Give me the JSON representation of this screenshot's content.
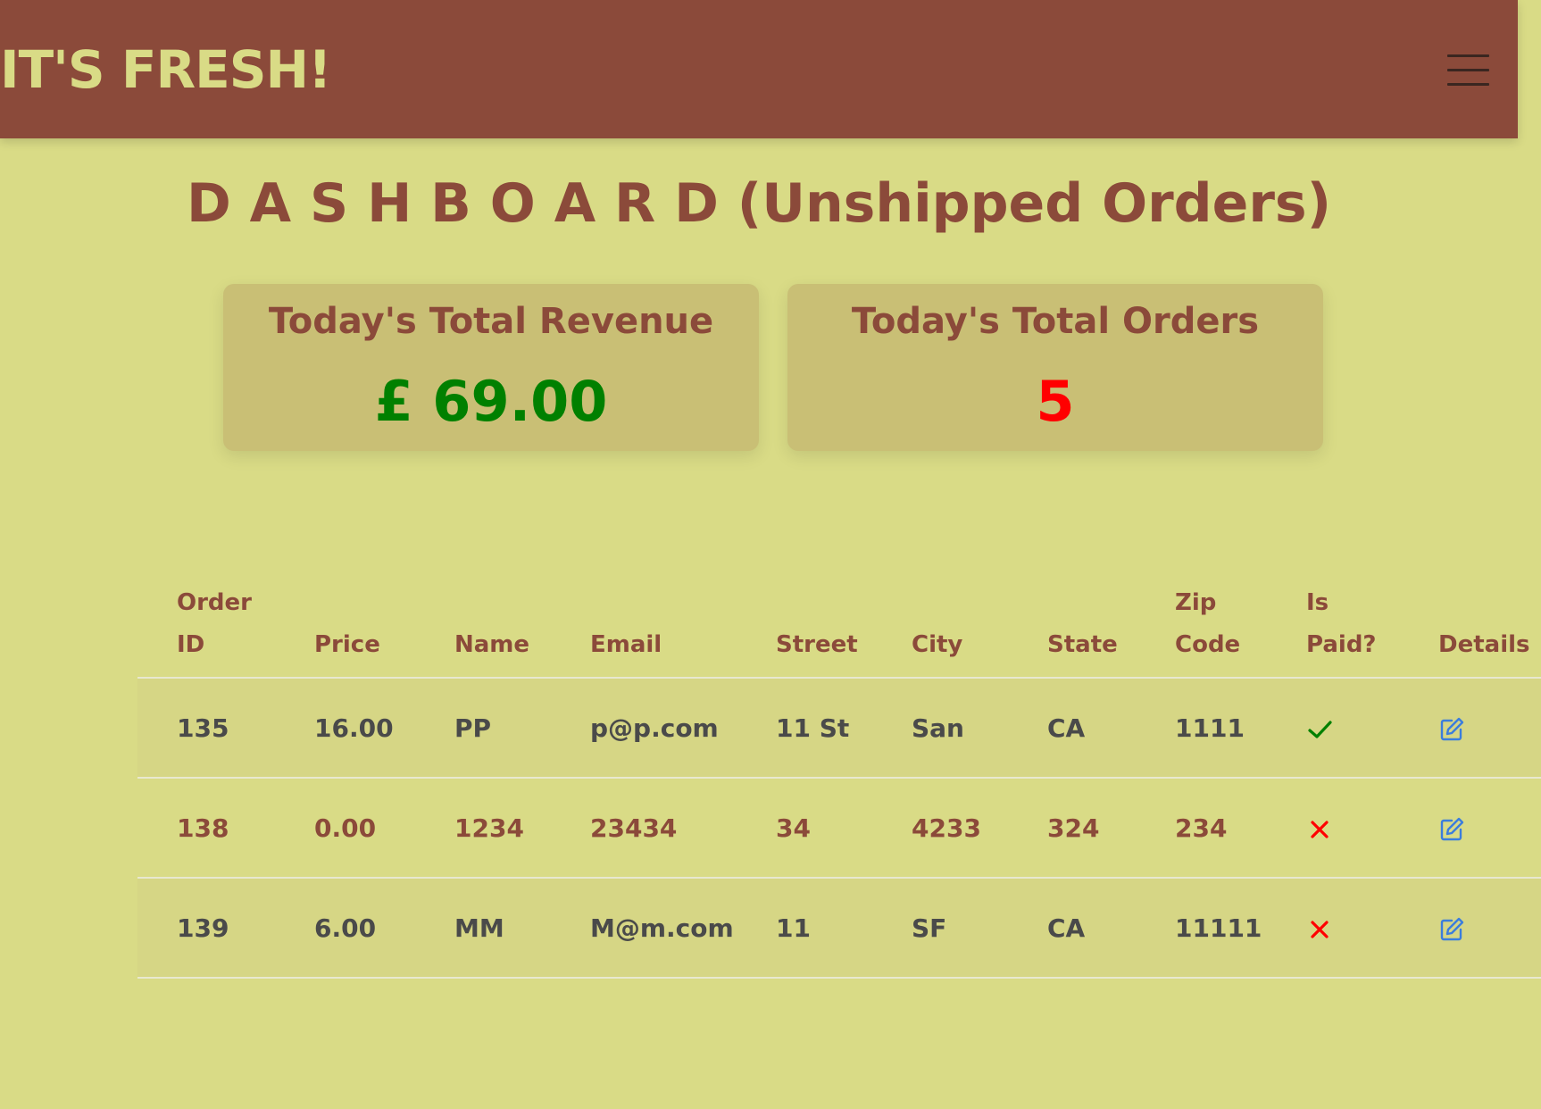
{
  "navbar": {
    "brand": "IT'S FRESH!",
    "menu_icon": "hamburger-menu-icon"
  },
  "page": {
    "title": "D A S H B O A R D (Unshipped Orders)"
  },
  "stats": {
    "revenue_label": "Today's Total Revenue",
    "revenue_value": "£ 69.00",
    "orders_label": "Today's Total Orders",
    "orders_value": "5"
  },
  "table": {
    "headers": [
      "Order ID",
      "Price",
      "Name",
      "Email",
      "Street",
      "City",
      "State",
      "Zip Code",
      "Is Paid?",
      "Details"
    ],
    "rows": [
      {
        "order_id": "135",
        "price": "16.00",
        "name": "PP",
        "email": "p@p.com",
        "street": "11 St",
        "city": "San",
        "state": "CA",
        "zip": "1111",
        "is_paid": true,
        "details_icon": "edit-icon"
      },
      {
        "order_id": "138",
        "price": "0.00",
        "name": "1234",
        "email": "23434",
        "street": "34",
        "city": "4233",
        "state": "324",
        "zip": "234",
        "is_paid": false,
        "details_icon": "edit-icon"
      },
      {
        "order_id": "139",
        "price": "6.00",
        "name": "MM",
        "email": "M@m.com",
        "street": "11",
        "city": "SF",
        "state": "CA",
        "zip": "11111",
        "is_paid": false,
        "details_icon": "edit-icon"
      }
    ]
  },
  "colors": {
    "background": "#d9db86",
    "navbar": "#8b4a3a",
    "card": "#c9bf75",
    "revenue": "#008000",
    "orders": "#ff0000",
    "paid_check": "#008000",
    "unpaid_cross": "#ff0000",
    "edit_icon": "#3b7ddd"
  }
}
